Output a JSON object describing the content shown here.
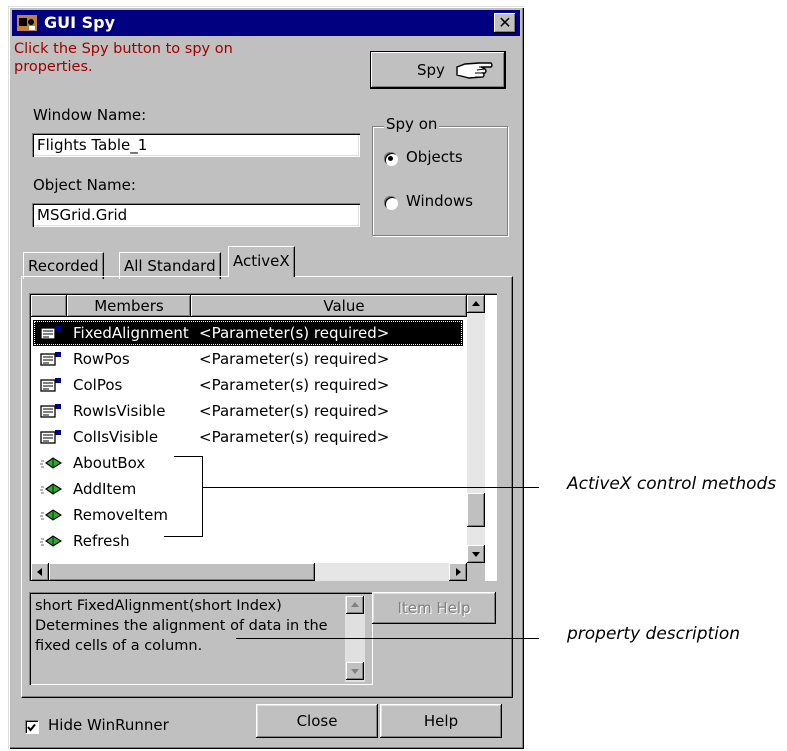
{
  "window": {
    "title": "GUI Spy",
    "close_glyph": "✕",
    "instruction": "Click the Spy button to spy on properties.",
    "spy_button": "Spy",
    "window_name_label": "Window Name:",
    "window_name_value": "Flights Table_1",
    "object_name_label": "Object Name:",
    "object_name_value": "MSGrid.Grid",
    "spy_on": {
      "label": "Spy on",
      "options": [
        {
          "label": "Objects",
          "checked": true
        },
        {
          "label": "Windows",
          "checked": false
        }
      ]
    },
    "tabs": [
      {
        "label": "Recorded",
        "active": false
      },
      {
        "label": "All Standard",
        "active": false
      },
      {
        "label": "ActiveX",
        "active": true
      }
    ],
    "table": {
      "columns": [
        "Members",
        "Value"
      ],
      "rows": [
        {
          "icon": "property-icon",
          "name": "FixedAlignment",
          "value": "<Parameter(s) required>",
          "selected": true
        },
        {
          "icon": "property-icon",
          "name": "RowPos",
          "value": "<Parameter(s) required>",
          "selected": false
        },
        {
          "icon": "property-icon",
          "name": "ColPos",
          "value": "<Parameter(s) required>",
          "selected": false
        },
        {
          "icon": "property-icon",
          "name": "RowIsVisible",
          "value": "<Parameter(s) required>",
          "selected": false
        },
        {
          "icon": "property-icon",
          "name": "ColIsVisible",
          "value": "<Parameter(s) required>",
          "selected": false
        },
        {
          "icon": "method-icon",
          "name": "AboutBox",
          "value": "",
          "selected": false
        },
        {
          "icon": "method-icon",
          "name": "AddItem",
          "value": "",
          "selected": false
        },
        {
          "icon": "method-icon",
          "name": "RemoveItem",
          "value": "",
          "selected": false
        },
        {
          "icon": "method-icon",
          "name": "Refresh",
          "value": "",
          "selected": false
        }
      ]
    },
    "description": "short FixedAlignment(short Index) Determines the alignment of data in the fixed cells of a column.",
    "item_help_button": "Item Help",
    "hide_winrunner": {
      "label": "Hide WinRunner",
      "checked": true
    },
    "close_button": "Close",
    "help_button": "Help"
  },
  "callouts": {
    "methods": "ActiveX control methods",
    "description": "property description"
  },
  "colors": {
    "title_bar": "#000080",
    "instruction_text": "#a00000",
    "dialog_face": "#c0c0c0",
    "method_icon_green": "#2ea82e"
  }
}
